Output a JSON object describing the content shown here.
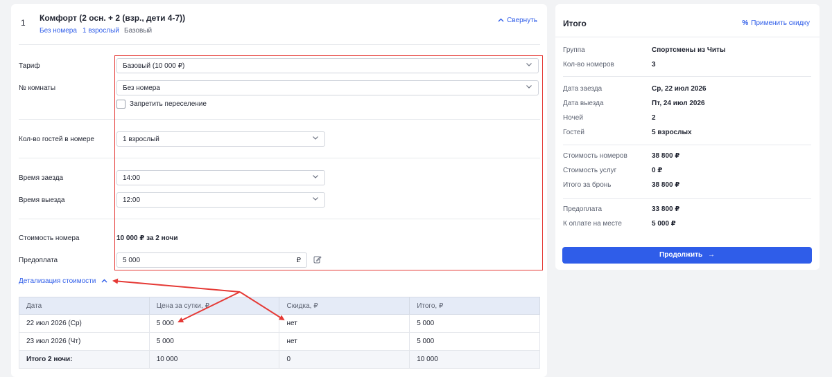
{
  "room": {
    "number": "1",
    "title": "Комфорт (2 осн. + 2 (взр., дети 4-7))",
    "tag_room": "Без номера",
    "tag_guests": "1 взрослый",
    "tag_rate": "Базовый",
    "collapse_label": "Свернуть"
  },
  "form": {
    "tariff_label": "Тариф",
    "tariff_value": "Базовый (10 000 ₽)",
    "room_label": "№ комнаты",
    "room_value": "Без номера",
    "no_relocation_label": "Запретить переселение",
    "guests_label": "Кол-во гостей в номере",
    "guests_value": "1 взрослый",
    "checkin_label": "Время заезда",
    "checkin_value": "14:00",
    "checkout_label": "Время выезда",
    "checkout_value": "12:00",
    "cost_label": "Стоимость номера",
    "cost_value": "10 000 ₽ за 2 ночи",
    "prepay_label": "Предоплата",
    "prepay_value": "5 000",
    "prepay_currency": "₽"
  },
  "details_link": "Детализация стоимости",
  "price_table": {
    "headers": [
      "Дата",
      "Цена за сутки, ₽",
      "Скидка, ₽",
      "Итого, ₽"
    ],
    "rows": [
      [
        "22 июл 2026 (Ср)",
        "5 000",
        "нет",
        "5 000"
      ],
      [
        "23 июл 2026 (Чт)",
        "5 000",
        "нет",
        "5 000"
      ]
    ],
    "total": [
      "Итого 2 ночи:",
      "10 000",
      "0",
      "10 000"
    ]
  },
  "summary": {
    "title": "Итого",
    "discount_label": "Применить скидку",
    "group_label": "Группа",
    "group_value": "Спортсмены из Читы",
    "rooms_label": "Кол-во номеров",
    "rooms_value": "3",
    "checkin_date_label": "Дата заезда",
    "checkin_date_value": "Ср, 22 июл 2026",
    "checkout_date_label": "Дата выезда",
    "checkout_date_value": "Пт, 24 июл 2026",
    "nights_label": "Ночей",
    "nights_value": "2",
    "guests_label": "Гостей",
    "guests_value": "5 взрослых",
    "rooms_cost_label": "Стоимость номеров",
    "rooms_cost_value": "38 800 ₽",
    "services_cost_label": "Стоимость услуг",
    "services_cost_value": "0 ₽",
    "booking_total_label": "Итого за бронь",
    "booking_total_value": "38 800 ₽",
    "prepay_label": "Предоплата",
    "prepay_value": "33 800 ₽",
    "onsite_label": "К оплате на месте",
    "onsite_value": "5 000 ₽",
    "continue_label": "Продолжить"
  },
  "colors": {
    "accent": "#2f5de9",
    "highlight": "#e53935"
  }
}
